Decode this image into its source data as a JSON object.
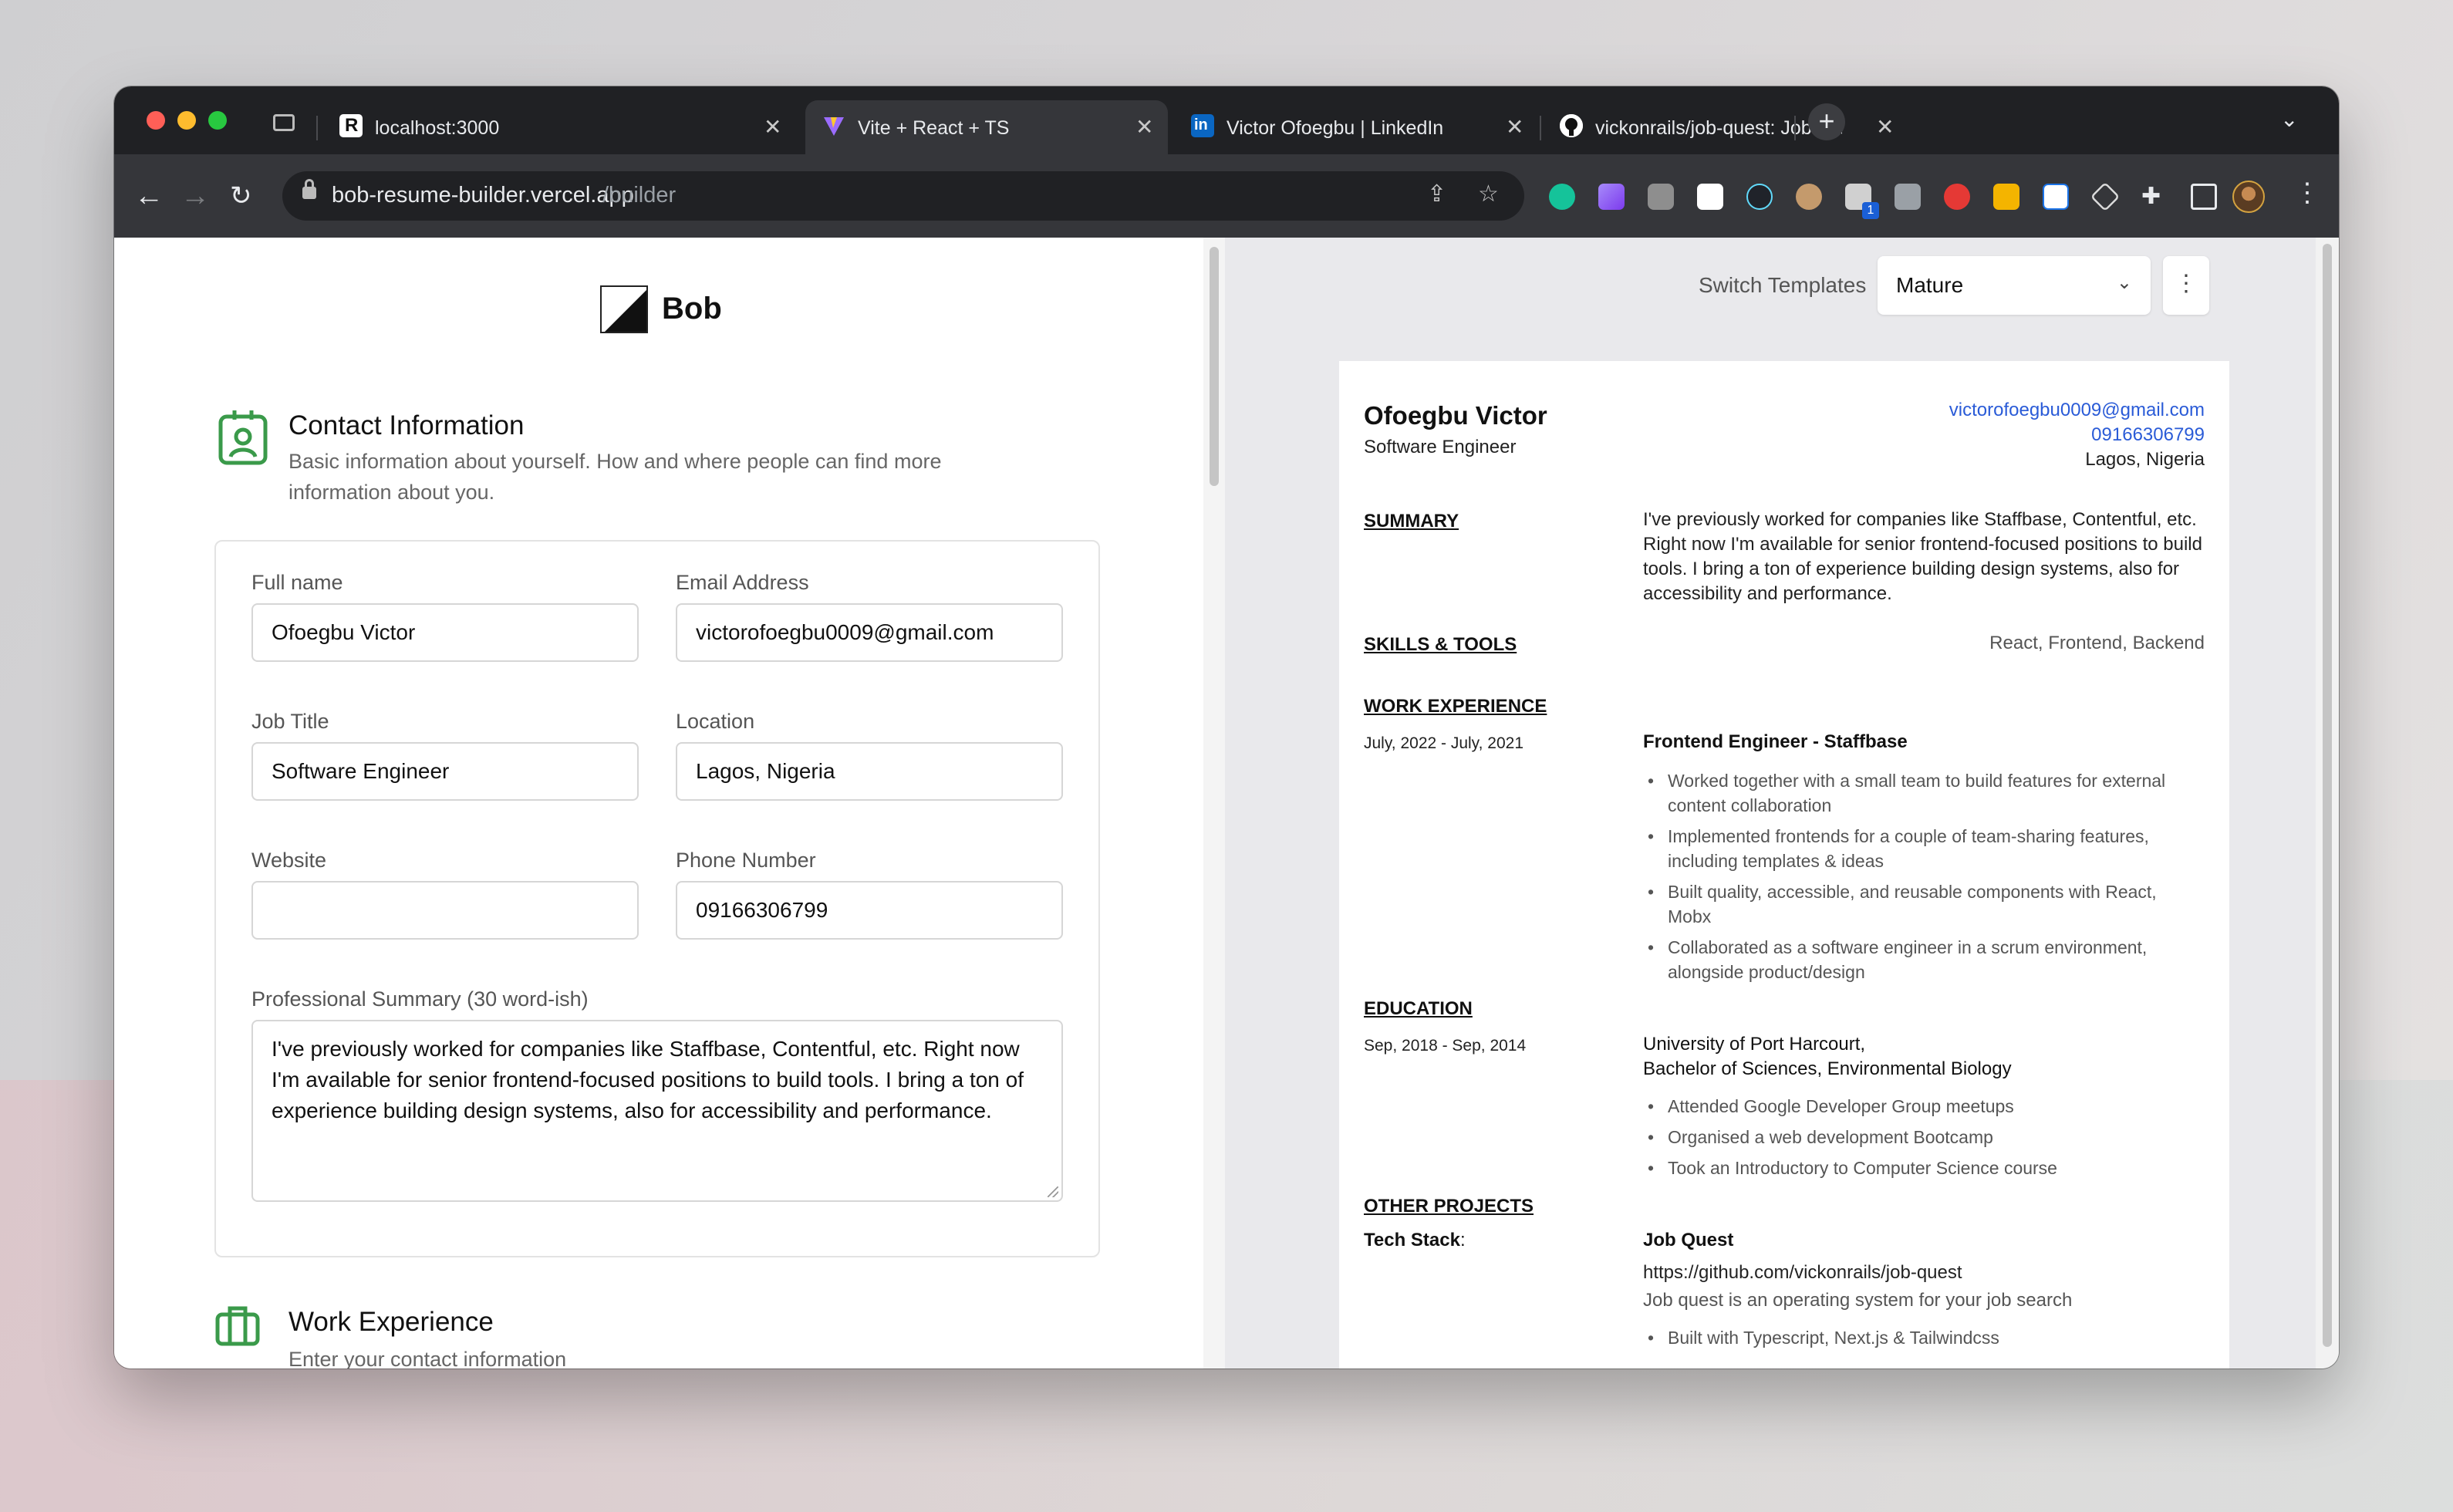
{
  "browser": {
    "tabs": [
      {
        "title": "localhost:3000"
      },
      {
        "title": "Vite + React + TS"
      },
      {
        "title": "Victor Ofoegbu | LinkedIn"
      },
      {
        "title": "vickonrails/job-quest: Job que"
      }
    ],
    "url_host": "bob-resume-builder.vercel.app",
    "url_path": "/builder",
    "extension_badge": "1"
  },
  "builder": {
    "logo_text": "Bob",
    "contact": {
      "title": "Contact Information",
      "description": "Basic information about yourself. How and where people can find more information about you.",
      "full_name": {
        "label": "Full name",
        "value": "Ofoegbu Victor"
      },
      "email": {
        "label": "Email Address",
        "value": "victorofoegbu0009@gmail.com"
      },
      "job_title": {
        "label": "Job Title",
        "value": "Software Engineer"
      },
      "location": {
        "label": "Location",
        "value": "Lagos, Nigeria"
      },
      "website": {
        "label": "Website",
        "value": ""
      },
      "phone": {
        "label": "Phone Number",
        "value": "09166306799"
      },
      "summary": {
        "label": "Professional Summary (30 word-ish)",
        "value": "I've previously worked for companies like Staffbase, Contentful, etc. Right now I'm available for senior frontend-focused positions to build tools. I bring a ton of experience building design systems, also for accessibility and performance."
      }
    },
    "work": {
      "title": "Work Experience",
      "description": "Enter your contact information"
    }
  },
  "preview": {
    "switch_label": "Switch Templates",
    "template": "Mature",
    "name": "Ofoegbu Victor",
    "job_title": "Software Engineer",
    "email": "victorofoegbu0009@gmail.com",
    "phone": "09166306799",
    "location": "Lagos, Nigeria",
    "summary_heading": "SUMMARY",
    "summary": "I've previously worked for companies like Staffbase, Contentful, etc. Right now I'm available for senior frontend-focused positions to build tools. I bring a ton of experience building design systems, also for accessibility and performance.",
    "skills_heading": "SKILLS & TOOLS",
    "skills": "React, Frontend, Backend",
    "work_heading": "WORK EXPERIENCE",
    "work_dates": "July, 2022 - July, 2021",
    "work_role": "Frontend Engineer - Staffbase",
    "work_bullets": [
      "Worked together with a small team to build features for external content collaboration",
      "Implemented frontends for a couple of team-sharing features, including templates & ideas",
      "Built quality, accessible, and reusable components with React, Mobx",
      "Collaborated as a software engineer in a scrum environment, alongside product/design"
    ],
    "education_heading": "EDUCATION",
    "edu_dates": "Sep, 2018 - Sep, 2014",
    "edu_school": "University of Port Harcourt,",
    "edu_degree": "Bachelor of Sciences, Environmental Biology",
    "edu_bullets": [
      "Attended Google Developer Group meetups",
      "Organised a web development Bootcamp",
      "Took an Introductory to Computer Science course"
    ],
    "projects_heading": "OTHER PROJECTS",
    "tech_stack_label": "Tech Stack",
    "tech_stack_colon": ":",
    "project_name": "Job Quest",
    "project_url": "https://github.com/vickonrails/job-quest",
    "project_desc": "Job quest is an operating system for your job search",
    "project_bullets": [
      "Built with Typescript, Next.js & Tailwindcss"
    ]
  }
}
